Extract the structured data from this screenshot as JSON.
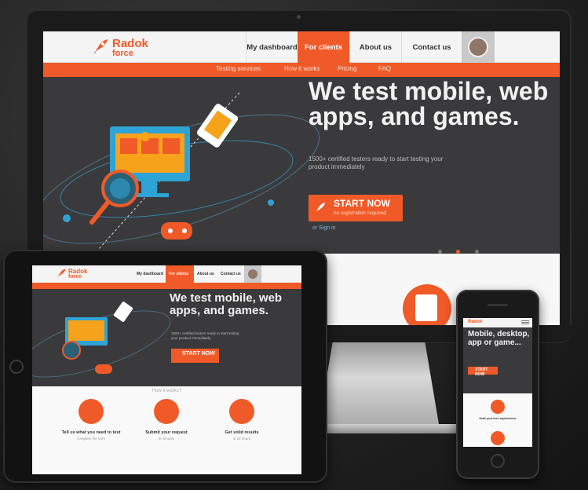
{
  "colors": {
    "accent": "#f05a28",
    "hero_bg": "#3a3a3c",
    "accent_blue": "#2ea3d6"
  },
  "brand": {
    "line1": "Radok",
    "line2": "force"
  },
  "nav": {
    "tabs": [
      {
        "label": "My dashboard"
      },
      {
        "label": "For clients",
        "active": true
      },
      {
        "label": "About us"
      },
      {
        "label": "Contact us"
      }
    ]
  },
  "subnav": {
    "items": [
      "Testing services",
      "How it works",
      "Pricing",
      "FAQ"
    ]
  },
  "hero": {
    "title": "We test mobile, web apps, and games.",
    "subtitle": "1500+ certified testers ready to start testing your product immediately",
    "cta_label": "START NOW",
    "cta_sub": "no registration required",
    "signin": "or Sign in",
    "slider": {
      "total": 3,
      "active": 2
    }
  },
  "tablet": {
    "how_title": "How it works?",
    "steps": [
      {
        "title": "Tell us what you need to test",
        "sub": "complete the form"
      },
      {
        "title": "Submit your request",
        "sub": "in minutes"
      },
      {
        "title": "Get solid results",
        "sub": "in 24 hours"
      }
    ]
  },
  "phone": {
    "title": "Mobile, desktop, app or game...",
    "cta_label": "START NOW",
    "step_title": "Draft your test requirements"
  },
  "icons": [
    "rocket-icon",
    "user-avatar-icon",
    "monitor-illustration-icon",
    "gamepad-icon",
    "magnifier-icon",
    "checklist-icon"
  ]
}
